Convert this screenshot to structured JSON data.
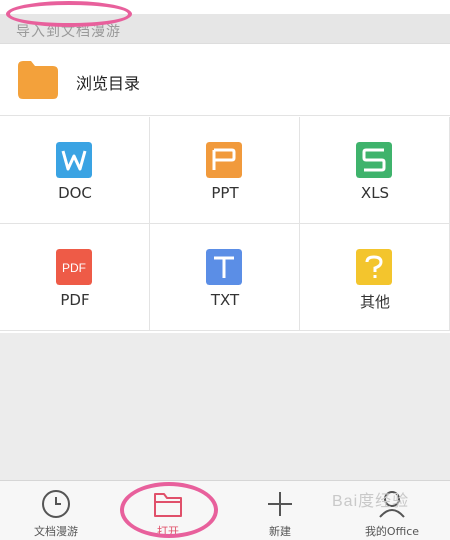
{
  "header": {
    "title": "导入到文档漫游"
  },
  "browse": {
    "label": "浏览目录",
    "icon": "folder-icon"
  },
  "file_types": [
    {
      "label": "DOC",
      "glyph": "W",
      "color": "#3aa3e3",
      "icon": "doc-icon"
    },
    {
      "label": "PPT",
      "glyph": "P",
      "color": "#f19a3c",
      "icon": "ppt-icon"
    },
    {
      "label": "XLS",
      "glyph": "S",
      "color": "#3fb36c",
      "icon": "xls-icon"
    },
    {
      "label": "PDF",
      "glyph": "PDF",
      "color": "#ee5b47",
      "icon": "pdf-icon"
    },
    {
      "label": "TXT",
      "glyph": "T",
      "color": "#5b8ee6",
      "icon": "txt-icon"
    },
    {
      "label": "其他",
      "glyph": "?",
      "color": "#f3c52d",
      "icon": "other-icon"
    }
  ],
  "tabbar": {
    "tabs": [
      {
        "label": "文档漫游",
        "icon": "clock-icon",
        "active": false
      },
      {
        "label": "打开",
        "icon": "folder-outline-icon",
        "active": true
      },
      {
        "label": "新建",
        "icon": "plus-icon",
        "active": false
      },
      {
        "label": "我的Office",
        "icon": "user-icon",
        "active": false
      }
    ]
  },
  "watermark": {
    "text": "Bai度经验"
  },
  "colors": {
    "accent": "#e0506a",
    "highlight": "#e8609c"
  }
}
